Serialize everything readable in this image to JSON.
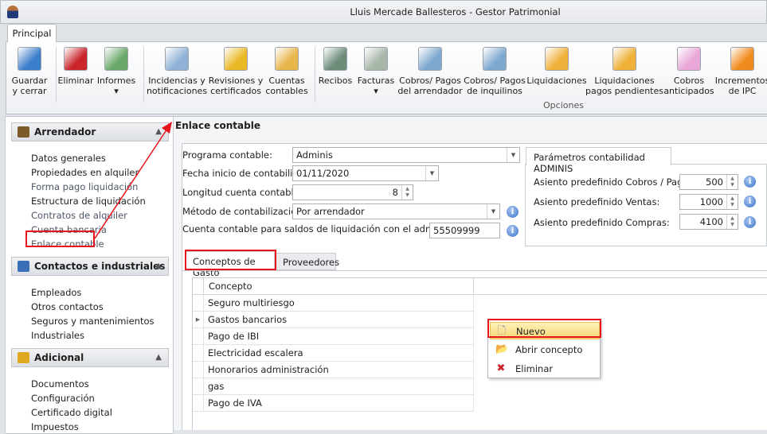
{
  "window": {
    "title": "Lluis Mercade Ballesteros - Gestor Patrimonial"
  },
  "ribbon": {
    "tab": "Principal",
    "group_label": "Opciones",
    "buttons": [
      {
        "l1": "Guardar",
        "l2": "y cerrar",
        "icon": "save-icon",
        "color": "#3b7ec9"
      },
      {
        "l1": "Eliminar",
        "l2": "",
        "icon": "delete-icon",
        "color": "#c9252b"
      },
      {
        "l1": "Informes",
        "l2": "▾",
        "icon": "report-icon",
        "color": "#6aa86a"
      },
      {
        "l1": "Incidencias y",
        "l2": "notificaciones",
        "icon": "incidents-icon",
        "color": "#8fb2d6"
      },
      {
        "l1": "Revisiones y",
        "l2": "certificados",
        "icon": "bell-icon",
        "color": "#e9b926"
      },
      {
        "l1": "Cuentas",
        "l2": "contables",
        "icon": "accounts-icon",
        "color": "#e8b64a"
      },
      {
        "l1": "Recibos",
        "l2": "",
        "icon": "receipt-icon",
        "color": "#6d8c7a"
      },
      {
        "l1": "Facturas",
        "l2": "▾",
        "icon": "invoice-icon",
        "color": "#a7b6a9"
      },
      {
        "l1": "Cobros/ Pagos",
        "l2": "del arrendador",
        "icon": "calculator-icon",
        "color": "#7fa8cf"
      },
      {
        "l1": "Cobros/ Pagos",
        "l2": "de inquilinos",
        "icon": "calculator-user-icon",
        "color": "#7fa8cf"
      },
      {
        "l1": "Liquidaciones",
        "l2": "",
        "icon": "settlement-icon",
        "color": "#f0b13a"
      },
      {
        "l1": "Liquidaciones",
        "l2": "pagos pendientes",
        "icon": "settlement-pending-icon",
        "color": "#f0b13a"
      },
      {
        "l1": "Cobros",
        "l2": "anticipados",
        "icon": "piggy-bank-icon",
        "color": "#e8a7d8"
      },
      {
        "l1": "Incrementos",
        "l2": "de IPC",
        "icon": "increase-icon",
        "color": "#f08a1e"
      }
    ]
  },
  "sidebar": {
    "groups": [
      {
        "title": "Arrendador",
        "items": [
          "Datos generales",
          "Propiedades en alquiler",
          "Forma pago liquidación",
          "Estructura de liquidación",
          "Contratos de alquiler",
          "Cuenta bancaria",
          "Enlace contable"
        ]
      },
      {
        "title": "Contactos e industriales",
        "items": [
          "Empleados",
          "Otros contactos",
          "Seguros y mantenimientos",
          "Industriales"
        ]
      },
      {
        "title": "Adicional",
        "items": [
          "Documentos",
          "Configuración",
          "Certificado digital",
          "Impuestos"
        ]
      }
    ]
  },
  "main": {
    "title": "Enlace contable",
    "form": {
      "programa_label": "Programa contable:",
      "programa_value": "Adminis",
      "fecha_label": "Fecha inicio de contabilidad:",
      "fecha_value": "01/11/2020",
      "longitud_label": "Longitud cuenta contable:",
      "longitud_value": "8",
      "metodo_label": "Método de contabilización:",
      "metodo_value": "Por arrendador",
      "cuenta_label": "Cuenta contable para saldos de liquidación con el administrador",
      "cuenta_value": "55509999"
    },
    "params": {
      "title": "Parámetros contabilidad ADMINIS",
      "cobros_label": "Asiento  predefinido Cobros / Pagos:",
      "cobros_value": "500",
      "ventas_label": "Asiento  predefinido Ventas:",
      "ventas_value": "1000",
      "compras_label": "Asiento predefinido Compras:",
      "compras_value": "4100"
    },
    "tabs": [
      "Conceptos de Gasto",
      "Proveedores"
    ],
    "grid": {
      "header": "Concepto",
      "rows": [
        "Seguro multiriesgo",
        "Gastos bancarios",
        "Pago de IBI",
        "Electricidad escalera",
        "Honorarios administración",
        "gas",
        "Pago de IVA"
      ]
    }
  },
  "context_menu": {
    "items": [
      "Nuevo",
      "Abrir concepto",
      "Eliminar"
    ]
  }
}
